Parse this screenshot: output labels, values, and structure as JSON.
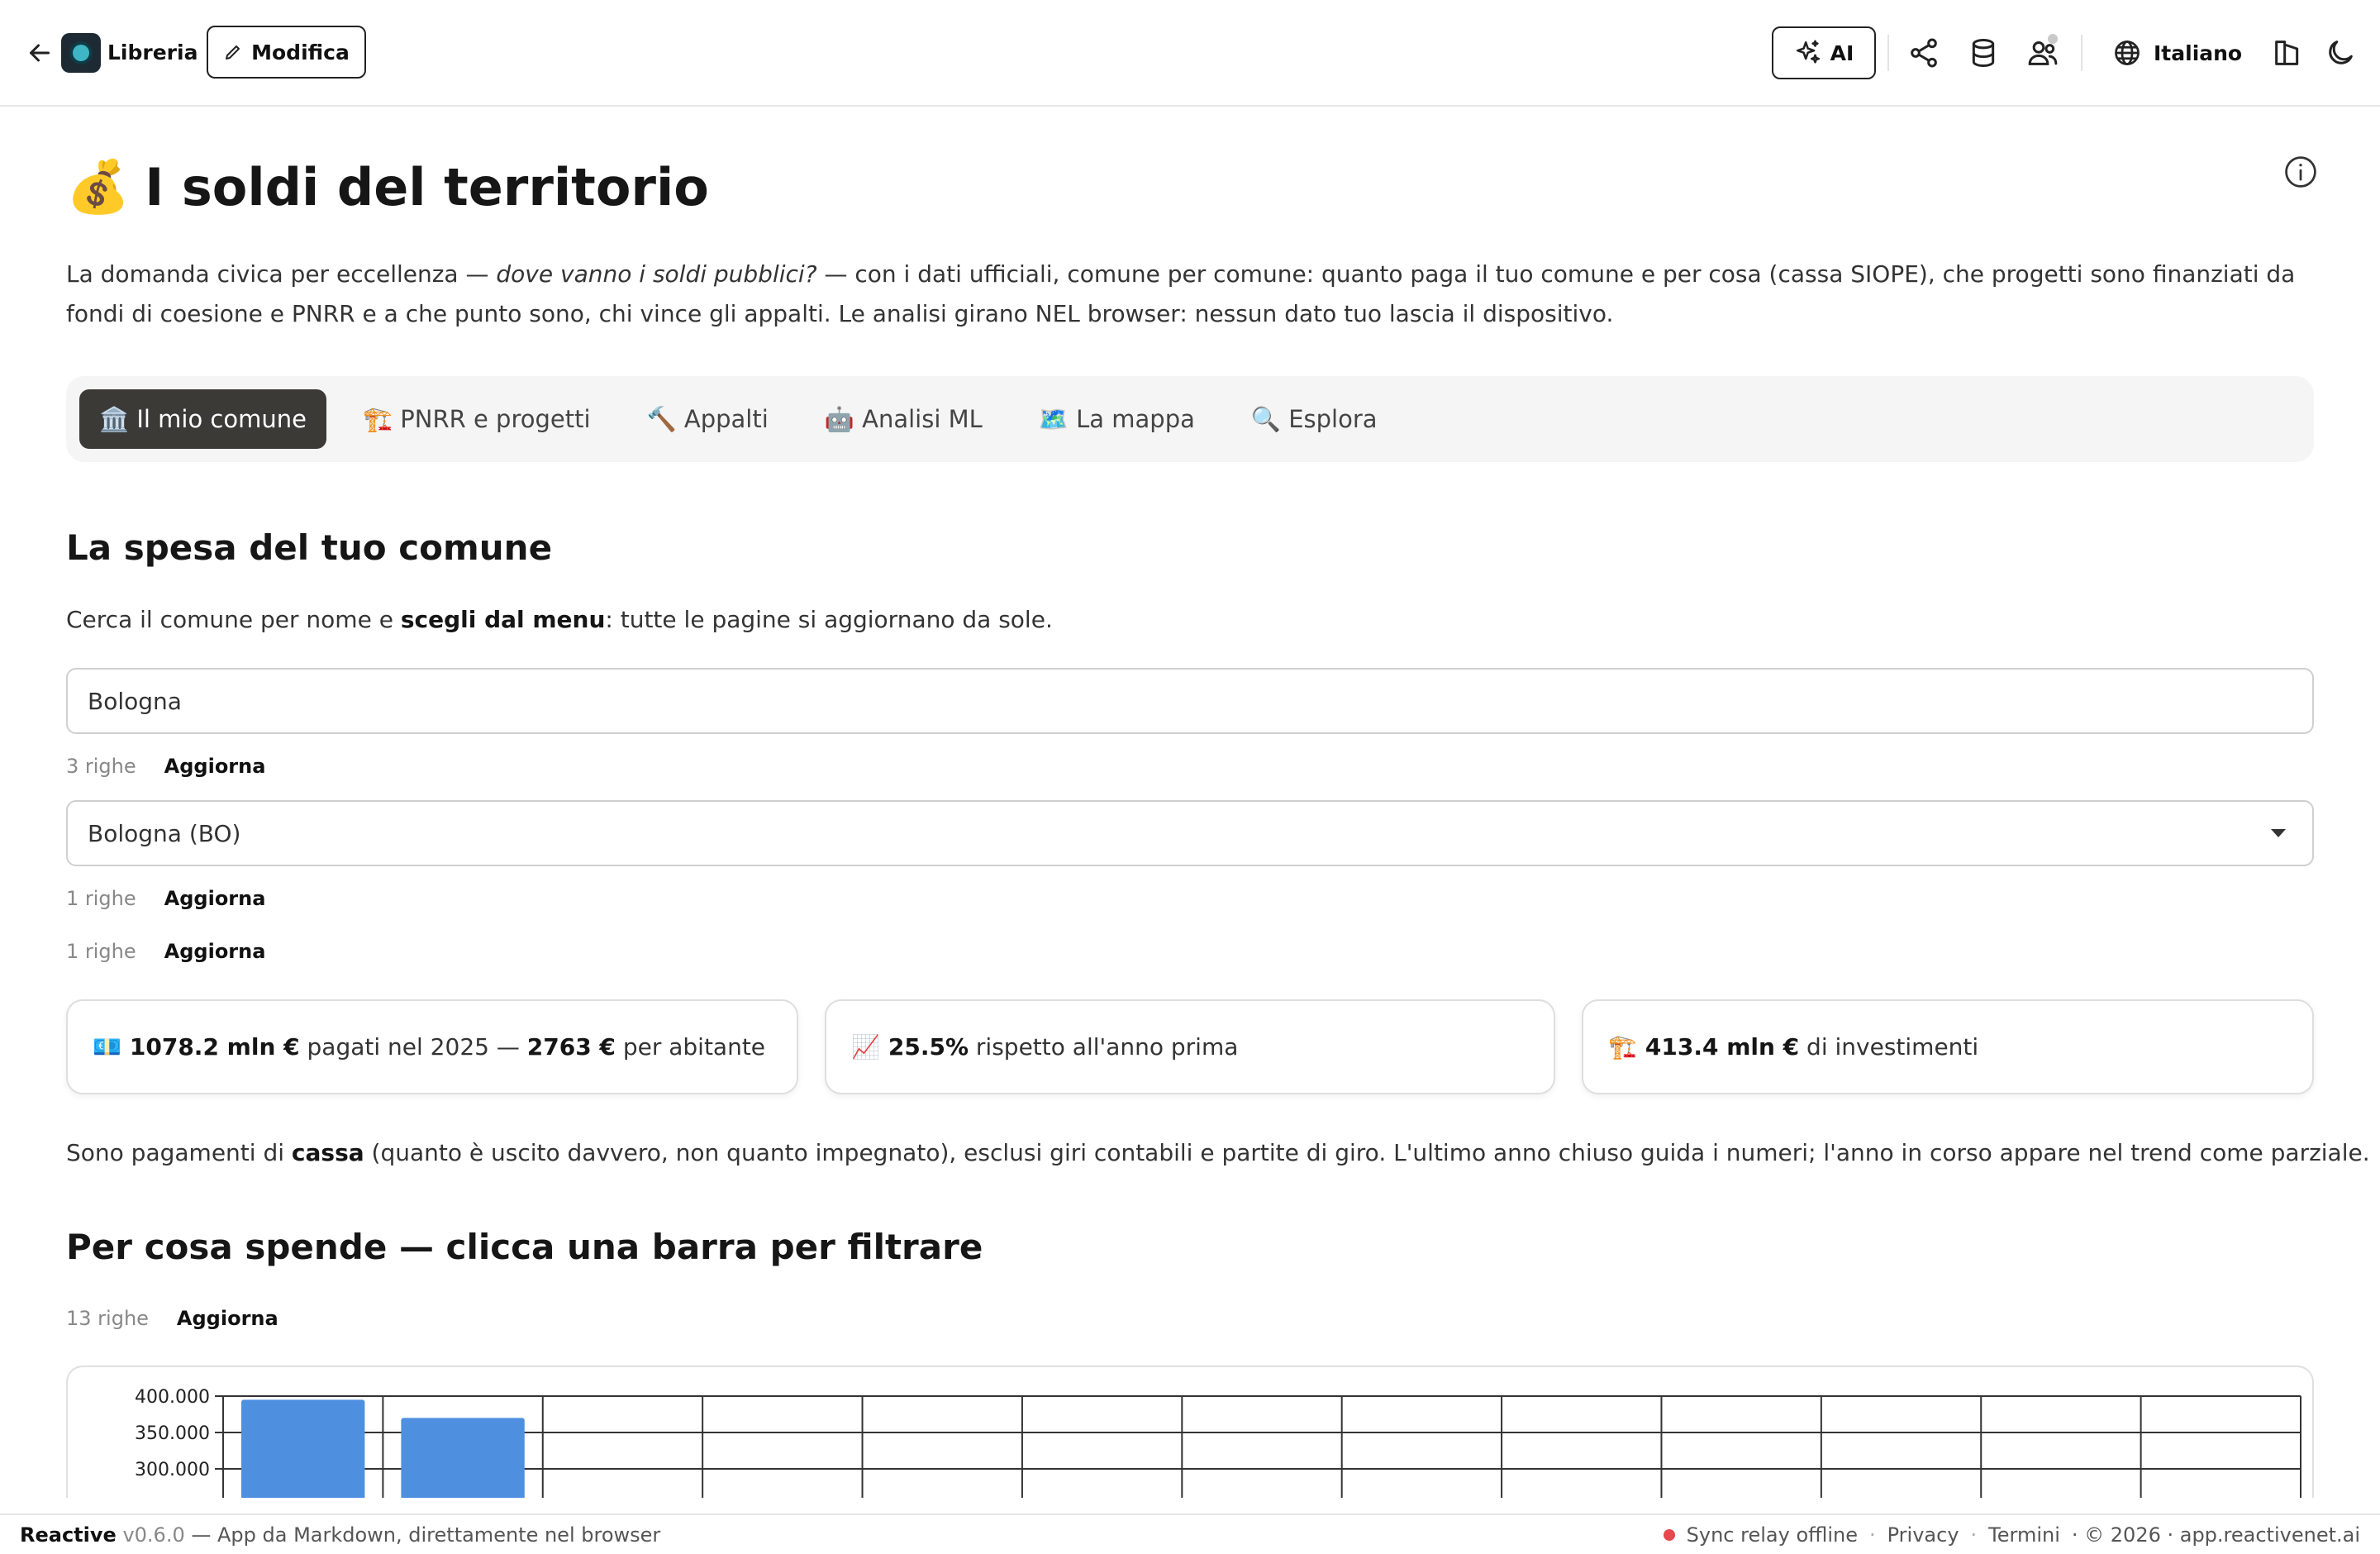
{
  "topbar": {
    "back_icon": "arrow-left-icon",
    "logo_icon": "app-logo-icon",
    "library_label": "Libreria",
    "edit_label": "Modifica",
    "ai_label": "AI",
    "language_label": "Italiano",
    "icons": [
      "share-icon",
      "database-icon",
      "users-icon",
      "globe-icon",
      "layout-icon",
      "moon-icon"
    ]
  },
  "page": {
    "title_emoji": "💰",
    "title": "I soldi del territorio",
    "intro_before": "La domanda civica per eccellenza — ",
    "intro_em": "dove vanno i soldi pubblici?",
    "intro_after": " — con i dati ufficiali, comune per comune: quanto paga il tuo comune e per cosa (cassa SIOPE), che progetti sono finanziati da fondi di coesione e PNRR e a che punto sono, chi vince gli appalti. Le analisi girano NEL browser: nessun dato tuo lascia il dispositivo."
  },
  "tabs": [
    {
      "label": "🏛️ Il mio comune",
      "active": true
    },
    {
      "label": "🏗️ PNRR e progetti",
      "active": false
    },
    {
      "label": "🔨 Appalti",
      "active": false
    },
    {
      "label": "🤖 Analisi ML",
      "active": false
    },
    {
      "label": "🗺️ La mappa",
      "active": false
    },
    {
      "label": "🔍 Esplora",
      "active": false
    }
  ],
  "section1": {
    "heading": "La spesa del tuo comune",
    "help_before": "Cerca il comune per nome e ",
    "help_bold": "scegli dal menu",
    "help_after": ": tutte le pagine si aggiornano da sole.",
    "search_value": "Bologna",
    "meta_search": {
      "rows": "3 righe",
      "update": "Aggiorna"
    },
    "select_value": "Bologna (BO)",
    "meta_select": {
      "rows": "1 righe",
      "update": "Aggiorna"
    },
    "meta_extra": {
      "rows": "1 righe",
      "update": "Aggiorna"
    }
  },
  "cards": [
    {
      "emoji": "💶",
      "bold1": "1078.2 mln €",
      "text1": " pagati nel 2025 — ",
      "bold2": "2763 €",
      "text2": " per abitante"
    },
    {
      "emoji": "📈",
      "bold1": "25.5%",
      "text1": " rispetto all'anno prima",
      "bold2": "",
      "text2": ""
    },
    {
      "emoji": "🏗️",
      "bold1": "413.4 mln €",
      "text1": " di investimenti",
      "bold2": "",
      "text2": ""
    }
  ],
  "note": {
    "before": "Sono pagamenti di ",
    "bold": "cassa",
    "after": " (quanto è uscito davvero, non quanto impegnato), esclusi giri contabili e partite di giro. L'ultimo anno chiuso guida i numeri; l'anno in corso appare nel trend come parziale."
  },
  "section2": {
    "heading": "Per cosa spende — clicca una barra per filtrare",
    "meta": {
      "rows": "13 righe",
      "update": "Aggiorna"
    }
  },
  "chart_data": {
    "type": "bar",
    "category_count": 13,
    "visible_y_ticks": [
      {
        "value": 400000,
        "label": "400.000"
      },
      {
        "value": 350000,
        "label": "350.000"
      },
      {
        "value": 300000,
        "label": "300.000"
      }
    ],
    "visible_values": [
      395000,
      370000
    ],
    "bar_color": "#4f8fdf",
    "grid": true
  },
  "footer": {
    "brand": "Reactive",
    "version": "v0.6.0",
    "tagline": " — App da Markdown, direttamente nel browser",
    "status": "Sync relay offline",
    "status_color": "#e5484d",
    "privacy": "Privacy",
    "terms": "Termini",
    "copyright": "· © 2026 · app.reactivenet.ai",
    "separator": "·"
  }
}
